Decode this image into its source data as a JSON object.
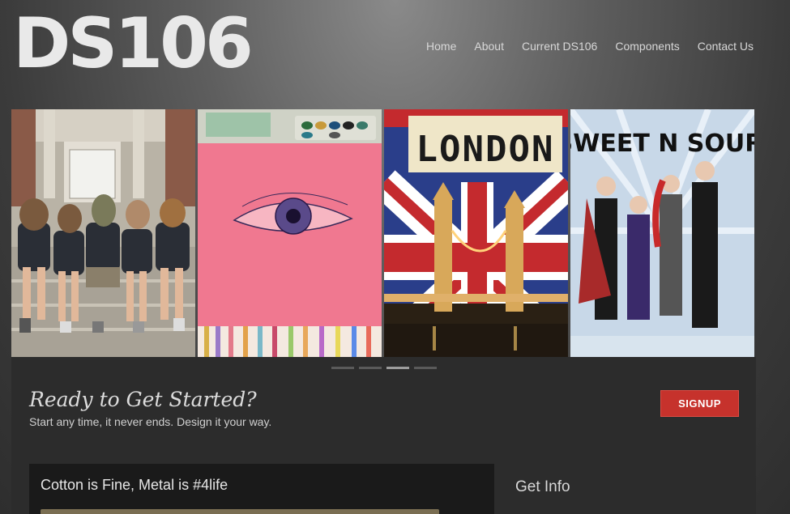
{
  "header": {
    "logo_text": "DS106",
    "nav": [
      "Home",
      "About",
      "Current DS106",
      "Components",
      "Contact Us"
    ]
  },
  "slider": {
    "slides": [
      {
        "name": "people-with-animal-masks"
      },
      {
        "name": "eye-drawing-watercolor"
      },
      {
        "name": "london-tower-bridge",
        "text": "LONDON"
      },
      {
        "name": "sweet-n-sour-poster",
        "text": "SWEET N SOUR"
      }
    ],
    "active_dot": 3,
    "dot_count": 4
  },
  "cta": {
    "title": "Ready to Get Started?",
    "subtitle": "Start any time, it never ends. Design it your way.",
    "button": "SIGNUP",
    "button_color": "#c6322c"
  },
  "post": {
    "title": "Cotton is Fine, Metal is #4life"
  },
  "sidebar": {
    "title": "Get Info"
  }
}
